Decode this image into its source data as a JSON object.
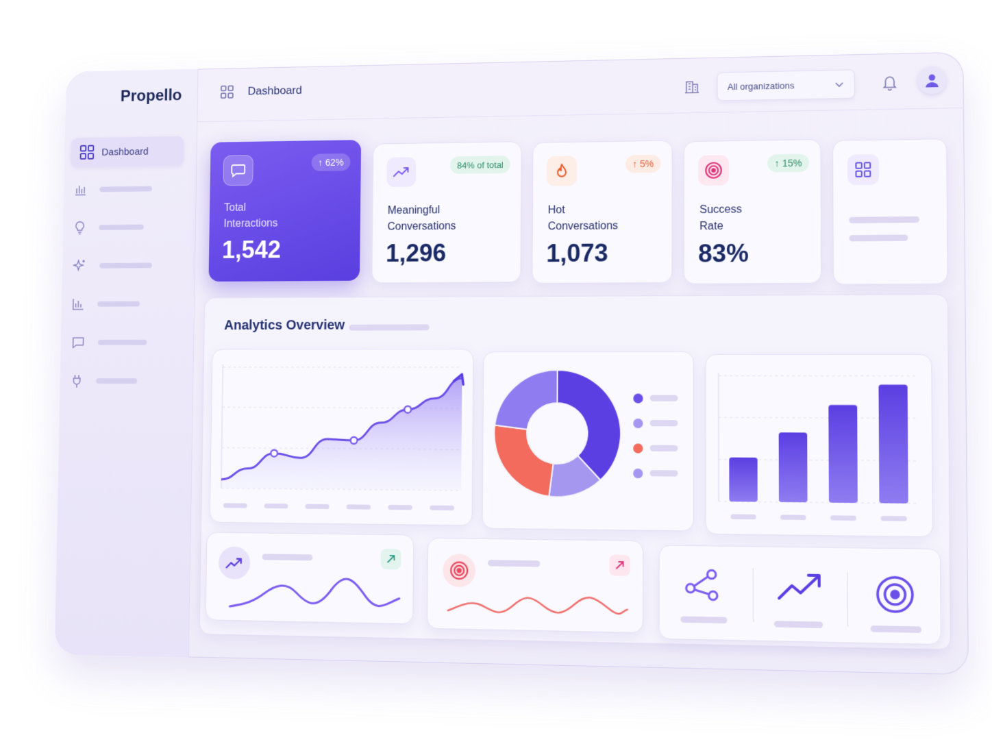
{
  "app": {
    "brand": "Propello"
  },
  "header": {
    "breadcrumb_label": "Dashboard",
    "org_select": {
      "value": "All organizations"
    },
    "icons": [
      "building-icon",
      "bell-icon",
      "user-avatar-icon",
      "grid-icon",
      "chevron-down-icon"
    ]
  },
  "sidebar": {
    "active_label": "Dashboard",
    "items": [
      {
        "icon": "bar-chart-icon"
      },
      {
        "icon": "lightbulb-icon"
      },
      {
        "icon": "sparkle-icon"
      },
      {
        "icon": "analytics-icon"
      },
      {
        "icon": "chat-icon"
      },
      {
        "icon": "plug-icon"
      }
    ]
  },
  "stats": [
    {
      "label_line1": "Total",
      "label_line2": "Interactions",
      "value": "1,542",
      "badge": "↑ 62%",
      "icon": "chat-bubble-icon"
    },
    {
      "label_line1": "Meaningful",
      "label_line2": "Conversations",
      "value": "1,296",
      "badge": "84% of total",
      "icon": "trend-up-icon"
    },
    {
      "label_line1": "Hot",
      "label_line2": "Conversations",
      "value": "1,073",
      "badge": "↑ 5%",
      "icon": "flame-icon"
    },
    {
      "label_line1": "Success",
      "label_line2": "Rate",
      "value": "83%",
      "badge": "↑ 15%",
      "icon": "target-icon"
    }
  ],
  "analytics": {
    "title": "Analytics Overview"
  },
  "colors": {
    "accent": "#5b3fe2",
    "accent_light": "#8f7cf0",
    "coral": "#f26b5c",
    "green_badge": "#2f8f6a",
    "orange_badge": "#e8623a",
    "navy_text": "#1b2a64"
  },
  "chart_data": [
    {
      "type": "area",
      "x": [
        1,
        2,
        3,
        4,
        5,
        6,
        7,
        8,
        9,
        10
      ],
      "series": [
        {
          "values": [
            8,
            18,
            32,
            28,
            45,
            44,
            60,
            72,
            82,
            100
          ]
        }
      ],
      "ylim": [
        0,
        110
      ],
      "grid": true
    },
    {
      "type": "pie",
      "donut": true,
      "series": [
        {
          "values": [
            38,
            14,
            25,
            23
          ]
        }
      ],
      "colors": [
        "#5b3fe2",
        "#a597f0",
        "#f26b5c",
        "#8f7cf0"
      ]
    },
    {
      "type": "bar",
      "series": [
        {
          "values": [
            35,
            55,
            77,
            93
          ]
        }
      ],
      "ylim": [
        0,
        100
      ],
      "grid": true
    }
  ]
}
